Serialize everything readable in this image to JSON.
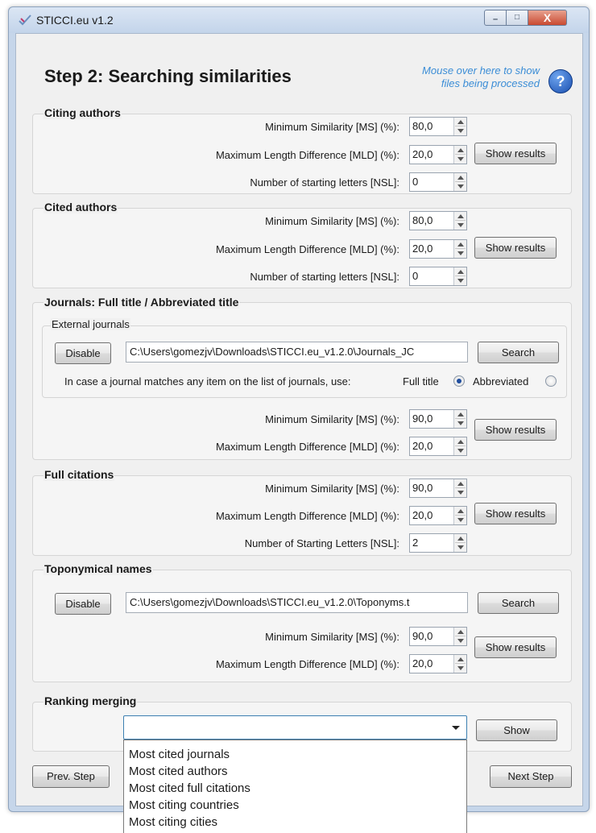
{
  "window": {
    "title": "STICCI.eu v1.2",
    "controls": {
      "minimize": "–",
      "maximize": "□",
      "close": "X"
    }
  },
  "header": {
    "step_title": "Step 2: Searching similarities",
    "hint_line1": "Mouse over here to show",
    "hint_line2": "files being processed",
    "help_glyph": "?"
  },
  "citing": {
    "title": "Citing authors",
    "ms_label": "Minimum Similarity [MS] (%):",
    "ms_value": "80,0",
    "mld_label": "Maximum Length Difference [MLD] (%):",
    "mld_value": "20,0",
    "nsl_label": "Number of starting letters [NSL]:",
    "nsl_value": "0",
    "show_results": "Show results"
  },
  "cited": {
    "title": "Cited authors",
    "ms_label": "Minimum Similarity [MS] (%):",
    "ms_value": "80,0",
    "mld_label": "Maximum Length Difference [MLD] (%):",
    "mld_value": "20,0",
    "nsl_label": "Number of starting letters [NSL]:",
    "nsl_value": "0",
    "show_results": "Show results"
  },
  "journals": {
    "title": "Journals: Full title / Abbreviated title",
    "external_title": "External journals",
    "disable": "Disable",
    "path": "C:\\Users\\gomezjv\\Downloads\\STICCI.eu_v1.2.0\\Journals_JC",
    "search": "Search",
    "match_text": "In case a journal matches any item on the list of journals, use:",
    "full_title": "Full title",
    "abbreviated": "Abbreviated",
    "selected": "Full title",
    "ms_label": "Minimum Similarity [MS] (%):",
    "ms_value": "90,0",
    "mld_label": "Maximum Length Difference [MLD] (%):",
    "mld_value": "20,0",
    "show_results": "Show results"
  },
  "full_citations": {
    "title": "Full citations",
    "ms_label": "Minimum Similarity [MS] (%):",
    "ms_value": "90,0",
    "mld_label": "Maximum Length Difference [MLD] (%):",
    "mld_value": "20,0",
    "nsl_label": "Number of Starting Letters [NSL]:",
    "nsl_value": "2",
    "show_results": "Show results"
  },
  "toponymical": {
    "title": "Toponymical names",
    "disable": "Disable",
    "path": "C:\\Users\\gomezjv\\Downloads\\STICCI.eu_v1.2.0\\Toponyms.t",
    "search": "Search",
    "ms_label": "Minimum Similarity [MS] (%):",
    "ms_value": "90,0",
    "mld_label": "Maximum Length Difference [MLD] (%):",
    "mld_value": "20,0",
    "show_results": "Show results"
  },
  "ranking": {
    "title": "Ranking merging",
    "selected": "",
    "show": "Show",
    "options": [
      "Most cited journals",
      "Most cited authors",
      "Most cited full citations",
      "Most citing countries",
      "Most citing cities"
    ]
  },
  "footer": {
    "prev": "Prev. Step",
    "next": "Next Step"
  }
}
